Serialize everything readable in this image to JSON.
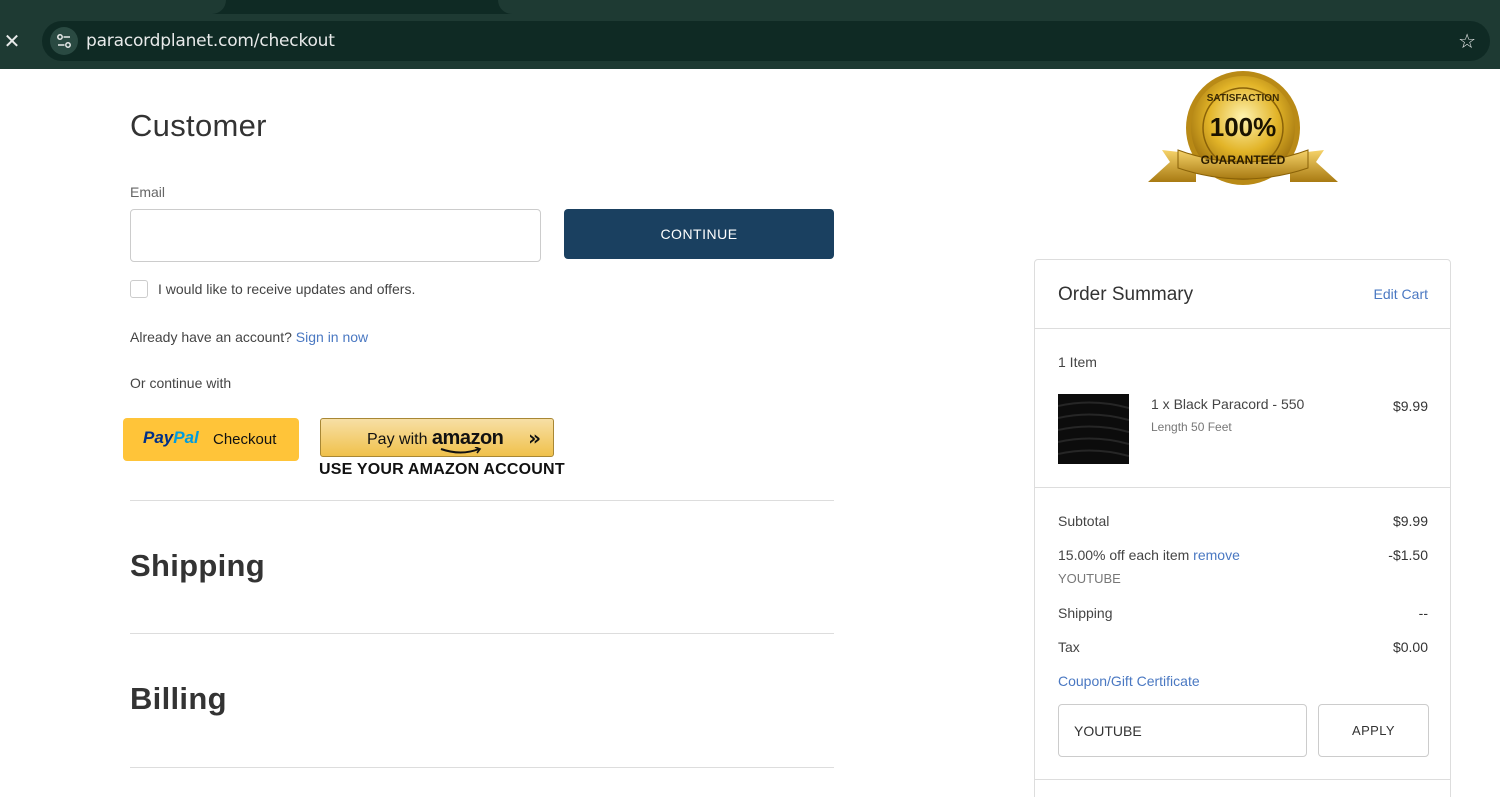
{
  "browser": {
    "url": "paracordplanet.com/checkout",
    "close_icon": "close-icon",
    "star_icon": "bookmark-star-icon"
  },
  "customer": {
    "title": "Customer",
    "email_label": "Email",
    "email_value": "",
    "continue_label": "CONTINUE",
    "updates_label": "I would like to receive updates and offers.",
    "account_prompt": "Already have an account?",
    "sign_in_label": "Sign in now",
    "or_continue": "Or continue with",
    "paypal": {
      "pay": "Pay",
      "pal": "Pal",
      "checkout": "Checkout"
    },
    "amazon": {
      "prefix": "Pay with",
      "brand": "amazon",
      "arrows": "»",
      "subtitle": "USE YOUR AMAZON ACCOUNT"
    }
  },
  "sections": {
    "shipping": "Shipping",
    "billing": "Billing"
  },
  "badge": {
    "top": "SATISFACTION",
    "middle": "100%",
    "bottom": "GUARANTEED"
  },
  "summary": {
    "title": "Order Summary",
    "edit_cart": "Edit Cart",
    "item_count": "1 Item",
    "item": {
      "name": "1 x Black Paracord - 550",
      "option": "Length 50 Feet",
      "price": "$9.99"
    },
    "subtotal_label": "Subtotal",
    "subtotal_value": "$9.99",
    "discount_label": "15.00% off each item",
    "discount_remove": "remove",
    "discount_value": "-$1.50",
    "discount_code": "YOUTUBE",
    "shipping_label": "Shipping",
    "shipping_value": "--",
    "tax_label": "Tax",
    "tax_value": "$0.00",
    "coupon_link": "Coupon/Gift Certificate",
    "coupon_value": "YOUTUBE",
    "apply_label": "APPLY"
  },
  "colors": {
    "continue_bg": "#1a4060",
    "link": "#4a78c2",
    "paypal_bg": "#ffc439",
    "chrome_bg": "#1e3a33"
  }
}
